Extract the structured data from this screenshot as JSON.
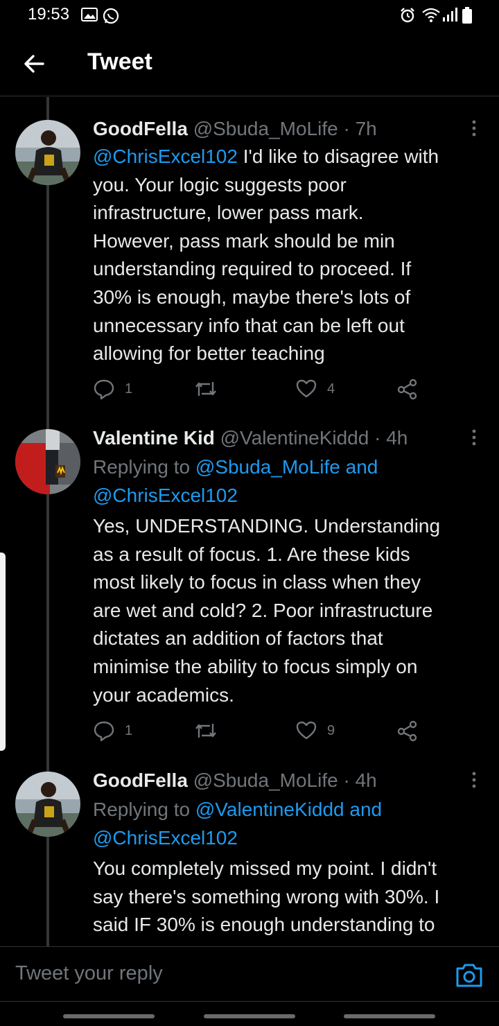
{
  "status_bar": {
    "time": "19:53",
    "icons": [
      "gallery-icon",
      "whatsapp-icon",
      "alarm-icon",
      "wifi-icon",
      "signal-icon",
      "battery-icon"
    ]
  },
  "header": {
    "title": "Tweet"
  },
  "tweets": [
    {
      "name": "GoodFella",
      "meta": "@Sbuda_MoLife · 7h",
      "replying_prefix": "",
      "replying_handles": "",
      "replying_handle2": "",
      "mention": "@ChrisExcel102",
      "lines": [
        " I'd like to disagree with",
        "you. Your logic suggests poor",
        "infrastructure, lower pass mark.",
        "However, pass mark should be min",
        "understanding required to proceed. If",
        "30% is enough, maybe there's lots of",
        "unnecessary info that can be left out",
        "allowing for better teaching"
      ],
      "replies": "1",
      "retweets": "",
      "likes": "4"
    },
    {
      "name": "Valentine Kid",
      "meta": "@ValentineKiddd · 4h",
      "replying_prefix": "Replying to ",
      "replying_handles": "@Sbuda_MoLife and",
      "replying_handle2": "@ChrisExcel102",
      "lines": [
        "Yes, UNDERSTANDING. Understanding",
        "as a result of focus. 1. Are these kids",
        "most likely to focus in class when they",
        "are wet and cold? 2. Poor infrastructure",
        "dictates an addition of factors that",
        "minimise the ability to focus simply on",
        "your academics."
      ],
      "replies": "1",
      "retweets": "",
      "likes": "9"
    },
    {
      "name": "GoodFella",
      "meta": "@Sbuda_MoLife · 4h",
      "replying_prefix": "Replying to ",
      "replying_handles": "@ValentineKiddd and",
      "replying_handle2": "@ChrisExcel102",
      "lines": [
        "You completely missed my point. I didn't",
        "say there's something wrong with 30%. I",
        "said IF 30% is enough understanding to"
      ]
    }
  ],
  "reply_bar": {
    "placeholder": "Tweet your reply"
  },
  "colors": {
    "accent": "#1d9bf0",
    "muted": "#71767b",
    "text": "#e7e9ea",
    "background": "#000000"
  }
}
